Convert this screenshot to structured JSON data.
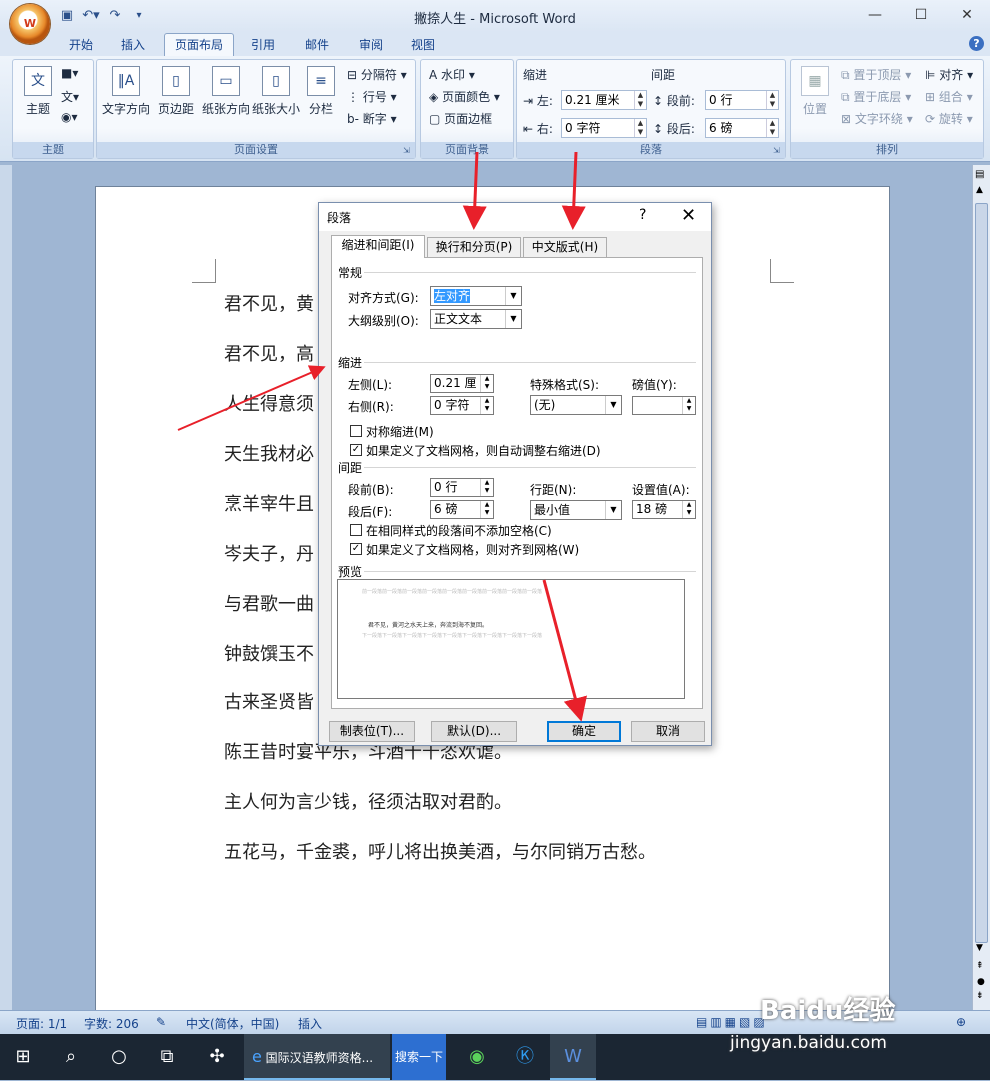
{
  "window": {
    "title": "撇捺人生 - Microsoft Word"
  },
  "tabs": [
    "开始",
    "插入",
    "页面布局",
    "引用",
    "邮件",
    "审阅",
    "视图"
  ],
  "active_tab": "页面布局",
  "ribbon": {
    "theme": {
      "group": "主题",
      "themes_label": "主题"
    },
    "page_setup": {
      "group": "页面设置",
      "text_direction": "文字方向",
      "margins": "页边距",
      "orientation": "纸张方向",
      "size": "纸张大小",
      "columns": "分栏",
      "breaks": "分隔符",
      "line_numbers": "行号",
      "hyphenation": "断字"
    },
    "page_background": {
      "group": "页面背景",
      "watermark": "水印",
      "page_color": "页面颜色",
      "page_borders": "页面边框"
    },
    "paragraph": {
      "group": "段落",
      "indent_title": "缩进",
      "spacing_title": "间距",
      "left_label": "左:",
      "left_value": "0.21 厘米",
      "right_label": "右:",
      "right_value": "0 字符",
      "before_label": "段前:",
      "before_value": "0 行",
      "after_label": "段后:",
      "after_value": "6 磅"
    },
    "arrange": {
      "group": "排列",
      "position": "位置",
      "bring_front": "置于顶层",
      "send_back": "置于底层",
      "text_wrap": "文字环绕",
      "align": "对齐",
      "group_btn": "组合",
      "rotate": "旋转"
    }
  },
  "document": {
    "lines": [
      "君不见，黄",
      "君不见，高",
      "人生得意须",
      "天生我材必",
      "烹羊宰牛且",
      "岑夫子，丹",
      "与君歌一曲",
      "钟鼓馔玉不",
      "古来圣贤皆",
      "陈王昔时宴平乐，斗酒十千恣欢谑。",
      "主人何为言少钱，径须沽取对君酌。",
      "五花马，千金裘，呼儿将出换美酒，与尔同销万古愁。"
    ]
  },
  "dialog": {
    "title": "段落",
    "help": "?",
    "close": "✕",
    "tabs": [
      "缩进和间距(I)",
      "换行和分页(P)",
      "中文版式(H)"
    ],
    "general": {
      "title": "常规",
      "alignment_label": "对齐方式(G):",
      "alignment_value": "左对齐",
      "outline_label": "大纲级别(O):",
      "outline_value": "正文文本"
    },
    "indent": {
      "title": "缩进",
      "left_label": "左侧(L):",
      "left_value": "0.21 厘",
      "right_label": "右侧(R):",
      "right_value": "0 字符",
      "special_label": "特殊格式(S):",
      "special_value": "(无)",
      "by_label": "磅值(Y):",
      "by_value": "",
      "mirror_label": "对称缩进(M)",
      "mirror_checked": false,
      "auto_adjust_label": "如果定义了文档网格，则自动调整右缩进(D)",
      "auto_adjust_checked": true
    },
    "spacing": {
      "title": "间距",
      "before_label": "段前(B):",
      "before_value": "0 行",
      "after_label": "段后(F):",
      "after_value": "6 磅",
      "line_label": "行距(N):",
      "line_value": "最小值",
      "at_label": "设置值(A):",
      "at_value": "18 磅",
      "no_space_label": "在相同样式的段落间不添加空格(C)",
      "no_space_checked": false,
      "snap_grid_label": "如果定义了文档网格，则对齐到网格(W)",
      "snap_grid_checked": true
    },
    "preview": {
      "title": "预览",
      "prev_text": "前一段落前一段落前一段落前一段落前一段落前一段落前一段落前一段落前一段落",
      "sample_text": "君不见，黄河之水天上来，奔流到海不复回。",
      "next_text": "下一段落下一段落下一段落下一段落下一段落下一段落下一段落下一段落下一段落"
    },
    "buttons": {
      "tabs": "制表位(T)...",
      "default": "默认(D)...",
      "ok": "确定",
      "cancel": "取消"
    }
  },
  "status": {
    "page": "页面: 1/1",
    "words": "字数: 206",
    "language": "中文(简体，中国)",
    "mode": "插入"
  },
  "taskbar": {
    "browser_item": "国际汉语教师资格...",
    "search_btn": "搜索一下"
  },
  "watermark": {
    "site": "jingyan.baidu.com",
    "brand": "Baidu经验"
  }
}
